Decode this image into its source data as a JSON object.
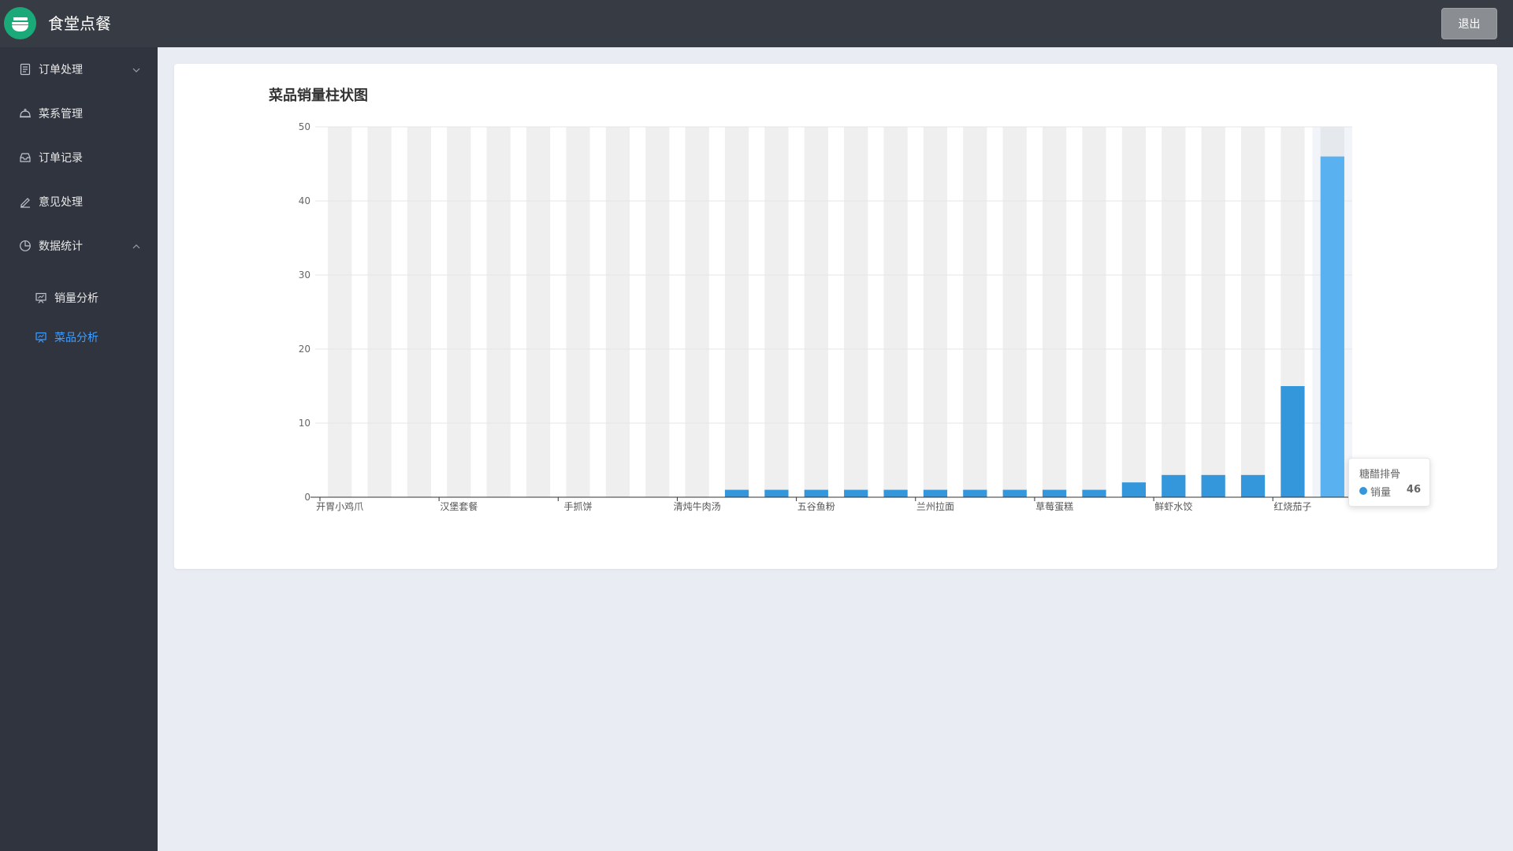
{
  "app": {
    "title": "食堂点餐",
    "logout_label": "退出",
    "logo_icon": "bowl-icon",
    "brand_color": "#1aa978"
  },
  "sidebar": {
    "items": [
      {
        "label": "订单处理",
        "icon": "document-icon",
        "arrow": "chevron-down-icon"
      },
      {
        "label": "菜系管理",
        "icon": "dish-cover-icon"
      },
      {
        "label": "订单记录",
        "icon": "inbox-icon"
      },
      {
        "label": "意见处理",
        "icon": "pencil-icon"
      },
      {
        "label": "数据统计",
        "icon": "pie-chart-icon",
        "arrow": "chevron-up-icon"
      }
    ],
    "sub_items": [
      {
        "label": "销量分析",
        "icon": "presentation-icon",
        "active": false
      },
      {
        "label": "菜品分析",
        "icon": "presentation-icon",
        "active": true
      }
    ],
    "active_color": "#409eff"
  },
  "chart_data": {
    "type": "bar",
    "title": "菜品销量柱状图",
    "ylim": [
      0,
      50
    ],
    "yticks": [
      0,
      10,
      20,
      30,
      40,
      50
    ],
    "visible_xtick_labels": [
      "开胃小鸡爪",
      "汉堡套餐",
      "手抓饼",
      "清炖牛肉汤",
      "五谷鱼粉",
      "兰州拉面",
      "草莓蛋糕",
      "鲜虾水饺",
      "红烧茄子"
    ],
    "categories": [
      "开胃小鸡爪",
      "",
      "",
      "汉堡套餐",
      "",
      "",
      "手抓饼",
      "",
      "",
      "清炖牛肉汤",
      "",
      "",
      "五谷鱼粉",
      "",
      "",
      "兰州拉面",
      "",
      "",
      "草莓蛋糕",
      "",
      "",
      "鲜虾水饺",
      "",
      "",
      "红烧茄子",
      "糖醋排骨"
    ],
    "series": [
      {
        "name": "销量",
        "values": [
          0,
          0,
          0,
          0,
          0,
          0,
          0,
          0,
          0,
          0,
          1,
          1,
          1,
          1,
          1,
          1,
          1,
          1,
          1,
          1,
          2,
          3,
          3,
          3,
          15,
          46
        ]
      }
    ],
    "bar_color": "#3497dc",
    "highlight_color": "#5ab1ef",
    "highlight_index": 25,
    "grid": true,
    "tooltip": {
      "category": "糖醋排骨",
      "series": "销量",
      "value": "46"
    }
  }
}
